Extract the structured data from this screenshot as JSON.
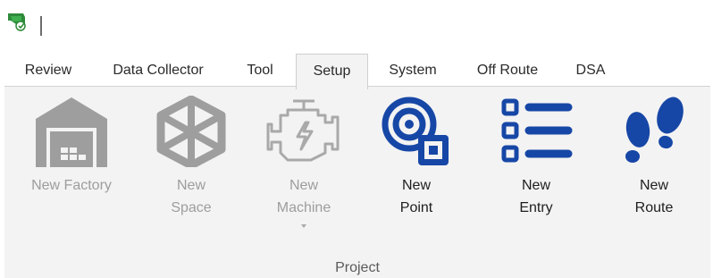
{
  "colors": {
    "accent_blue": "#1747a6",
    "disabled_gray": "#9e9e9e",
    "ribbon_bg": "#f3f3f3",
    "app_icon_green": "#2e8b3a"
  },
  "tabs": [
    {
      "label": "Review",
      "active": false
    },
    {
      "label": "Data Collector",
      "active": false
    },
    {
      "label": "Tool",
      "active": false
    },
    {
      "label": "Setup",
      "active": true
    },
    {
      "label": "System",
      "active": false
    },
    {
      "label": "Off Route",
      "active": false
    },
    {
      "label": "DSA",
      "active": false
    }
  ],
  "ribbon": {
    "group_label": "Project",
    "buttons": [
      {
        "icon": "factory-icon",
        "line1": "New Factory",
        "line2": "",
        "enabled": false
      },
      {
        "icon": "cube-icon",
        "line1": "New",
        "line2": "Space",
        "enabled": false
      },
      {
        "icon": "engine-icon",
        "line1": "New",
        "line2": "Machine",
        "enabled": false,
        "has_dropdown": true
      },
      {
        "icon": "point-sensor-icon",
        "line1": "New",
        "line2": "Point",
        "enabled": true
      },
      {
        "icon": "list-icon",
        "line1": "New",
        "line2": "Entry",
        "enabled": true
      },
      {
        "icon": "footprints-icon",
        "line1": "New",
        "line2": "Route",
        "enabled": true
      }
    ]
  }
}
